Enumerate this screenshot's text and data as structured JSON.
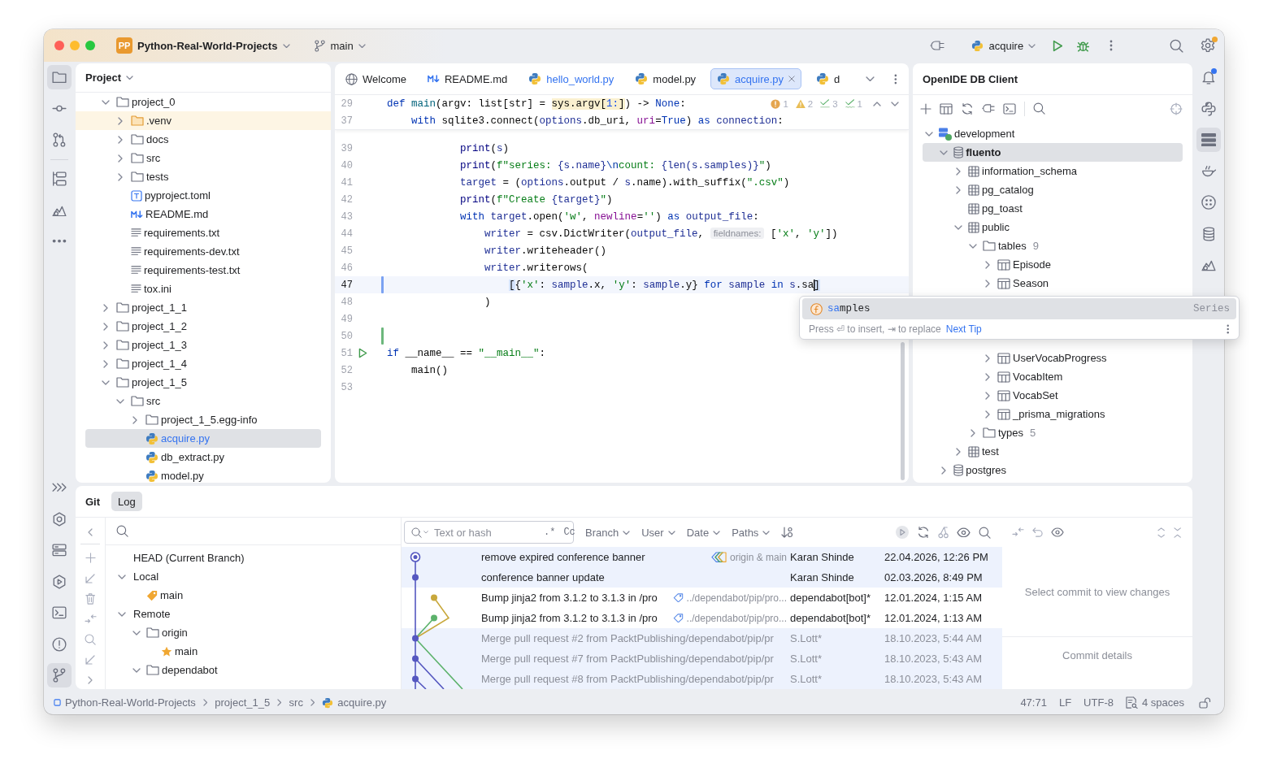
{
  "window": {
    "project_badge": "PP",
    "project_name": "Python-Real-World-Projects",
    "branch": "main",
    "run_config": "acquire",
    "settings_badge": true
  },
  "left_toolbar": {
    "top_groups": [
      [
        {
          "kind": "project",
          "selected": true
        },
        {
          "kind": "commit",
          "selected": false
        },
        {
          "kind": "pullrequests",
          "selected": false
        }
      ],
      [
        {
          "kind": "structure",
          "selected": false
        },
        {
          "kind": "packages",
          "selected": false
        },
        {
          "kind": "more",
          "selected": false
        }
      ]
    ],
    "bottom": [
      {
        "kind": "expand",
        "selected": false
      },
      {
        "kind": "pythonpackages",
        "selected": false
      },
      {
        "kind": "services",
        "selected": false
      },
      {
        "kind": "run",
        "selected": false
      },
      {
        "kind": "terminal",
        "selected": false
      },
      {
        "kind": "problems",
        "selected": false
      },
      {
        "kind": "git",
        "selected": true
      }
    ]
  },
  "right_toolbar": [
    {
      "kind": "notifications",
      "selected": false,
      "badge": true
    },
    {
      "kind": "console",
      "selected": false,
      "badge": false
    },
    {
      "kind": "dbclient",
      "selected": true,
      "badge": false
    },
    {
      "kind": "pot",
      "selected": false,
      "badge": false
    },
    {
      "kind": "dots",
      "selected": false,
      "badge": false
    },
    {
      "kind": "database",
      "selected": false,
      "badge": false
    },
    {
      "kind": "mountain",
      "selected": false,
      "badge": false
    }
  ],
  "project_panel": {
    "title": "Project",
    "tree": [
      {
        "label": "project_0",
        "kind": "folder",
        "expanded": true,
        "selected": false,
        "modified": false,
        "children": [
          {
            "label": ".venv",
            "kind": "venv",
            "expanded": false,
            "selected": false,
            "modified": false
          },
          {
            "label": "docs",
            "kind": "folder",
            "expanded": false,
            "selected": false,
            "modified": false
          },
          {
            "label": "src",
            "kind": "folder",
            "expanded": false,
            "selected": false,
            "modified": false
          },
          {
            "label": "tests",
            "kind": "folder",
            "expanded": false,
            "selected": false,
            "modified": false
          },
          {
            "label": "pyproject.toml",
            "kind": "toml",
            "selected": false,
            "modified": false
          },
          {
            "label": "README.md",
            "kind": "markdown",
            "selected": false,
            "modified": false
          },
          {
            "label": "requirements.txt",
            "kind": "text",
            "selected": false,
            "modified": false
          },
          {
            "label": "requirements-dev.txt",
            "kind": "text",
            "selected": false,
            "modified": false
          },
          {
            "label": "requirements-test.txt",
            "kind": "text",
            "selected": false,
            "modified": false
          },
          {
            "label": "tox.ini",
            "kind": "text",
            "selected": false,
            "modified": false
          }
        ]
      },
      {
        "label": "project_1_1",
        "kind": "folder",
        "expanded": false,
        "selected": false,
        "modified": false
      },
      {
        "label": "project_1_2",
        "kind": "folder",
        "expanded": false,
        "selected": false,
        "modified": false
      },
      {
        "label": "project_1_3",
        "kind": "folder",
        "expanded": false,
        "selected": false,
        "modified": false
      },
      {
        "label": "project_1_4",
        "kind": "folder",
        "expanded": false,
        "selected": false,
        "modified": false
      },
      {
        "label": "project_1_5",
        "kind": "folder",
        "expanded": true,
        "selected": false,
        "modified": false,
        "children": [
          {
            "label": "src",
            "kind": "folder",
            "expanded": true,
            "selected": false,
            "modified": false,
            "children": [
              {
                "label": "project_1_5.egg-info",
                "kind": "folder",
                "expanded": false,
                "selected": false,
                "modified": false
              },
              {
                "label": "acquire.py",
                "kind": "python",
                "selected": true,
                "modified": true
              },
              {
                "label": "db_extract.py",
                "kind": "python",
                "selected": false,
                "modified": false
              },
              {
                "label": "model.py",
                "kind": "python",
                "selected": false,
                "modified": false
              }
            ]
          }
        ]
      }
    ]
  },
  "editor": {
    "tabs": [
      {
        "label": "Welcome",
        "kind": "welcome",
        "selected": false,
        "modified": false
      },
      {
        "label": "README.md",
        "kind": "markdown",
        "selected": false,
        "modified": false
      },
      {
        "label": "hello_world.py",
        "kind": "python",
        "selected": false,
        "modified": true
      },
      {
        "label": "model.py",
        "kind": "python",
        "selected": false,
        "modified": false
      },
      {
        "label": "acquire.py",
        "kind": "python",
        "selected": true,
        "modified": true
      },
      {
        "label": "d",
        "kind": "python",
        "selected": false,
        "modified": false
      }
    ],
    "inspections": [
      {
        "kind": "error",
        "count": "1"
      },
      {
        "kind": "warning",
        "count": "2"
      },
      {
        "kind": "weak",
        "count": "3"
      },
      {
        "kind": "typo",
        "count": "1"
      }
    ],
    "sticky_lines": [
      {
        "number": "29",
        "tokens": [
          {
            "text": "def ",
            "kind": "keyword"
          },
          {
            "text": "main",
            "kind": "function"
          },
          {
            "text": "(argv: list[str] = ",
            "kind": "plain"
          },
          {
            "text": "sys.argv[",
            "kind": "warning"
          },
          {
            "text": "1:",
            "kind": "warning-number"
          },
          {
            "text": "]",
            "kind": "warning"
          },
          {
            "text": ") -> ",
            "kind": "plain"
          },
          {
            "text": "None",
            "kind": "keyword"
          },
          {
            "text": ":",
            "kind": "plain"
          }
        ]
      },
      {
        "number": "37",
        "tokens": [
          {
            "text": "    with",
            "kind": "keyword"
          },
          {
            "text": " sqlite3.connect(",
            "kind": "plain"
          },
          {
            "text": "options",
            "kind": "var"
          },
          {
            "text": ".db_uri, ",
            "kind": "plain"
          },
          {
            "text": "uri",
            "kind": "kwarg"
          },
          {
            "text": "=",
            "kind": "plain"
          },
          {
            "text": "True",
            "kind": "keyword"
          },
          {
            "text": ") ",
            "kind": "plain"
          },
          {
            "text": "as",
            "kind": "keyword"
          },
          {
            "text": " connection",
            "kind": "var"
          },
          {
            "text": ":",
            "kind": "plain"
          }
        ]
      }
    ],
    "lines": [
      {
        "number": "39",
        "current": false,
        "runnable": false,
        "tokens": [
          {
            "text": "            print",
            "kind": "builtin"
          },
          {
            "text": "(",
            "kind": "plain"
          },
          {
            "text": "s",
            "kind": "var"
          },
          {
            "text": ")",
            "kind": "plain"
          }
        ]
      },
      {
        "number": "40",
        "current": false,
        "runnable": false,
        "tokens": [
          {
            "text": "            print",
            "kind": "builtin"
          },
          {
            "text": "(",
            "kind": "plain"
          },
          {
            "text": "f\"series: ",
            "kind": "string"
          },
          {
            "text": "{s.name}",
            "kind": "var"
          },
          {
            "text": "\\n",
            "kind": "escape"
          },
          {
            "text": "count: ",
            "kind": "string"
          },
          {
            "text": "{len(s.samples)}",
            "kind": "var"
          },
          {
            "text": "\"",
            "kind": "string"
          },
          {
            "text": ")",
            "kind": "plain"
          }
        ]
      },
      {
        "number": "41",
        "current": false,
        "runnable": false,
        "tokens": [
          {
            "text": "            target",
            "kind": "var"
          },
          {
            "text": " = (",
            "kind": "plain"
          },
          {
            "text": "options",
            "kind": "var"
          },
          {
            "text": ".output / ",
            "kind": "plain"
          },
          {
            "text": "s",
            "kind": "var"
          },
          {
            "text": ".name).with_suffix(",
            "kind": "plain"
          },
          {
            "text": "\".csv\"",
            "kind": "string"
          },
          {
            "text": ")",
            "kind": "plain"
          }
        ]
      },
      {
        "number": "42",
        "current": false,
        "runnable": false,
        "tokens": [
          {
            "text": "            print",
            "kind": "builtin"
          },
          {
            "text": "(",
            "kind": "plain"
          },
          {
            "text": "f\"Create ",
            "kind": "string"
          },
          {
            "text": "{target}",
            "kind": "var"
          },
          {
            "text": "\"",
            "kind": "string"
          },
          {
            "text": ")",
            "kind": "plain"
          }
        ]
      },
      {
        "number": "43",
        "current": false,
        "runnable": false,
        "tokens": [
          {
            "text": "            with",
            "kind": "keyword"
          },
          {
            "text": " target",
            "kind": "var"
          },
          {
            "text": ".open(",
            "kind": "plain"
          },
          {
            "text": "'w'",
            "kind": "string"
          },
          {
            "text": ", ",
            "kind": "plain"
          },
          {
            "text": "newline",
            "kind": "kwarg"
          },
          {
            "text": "=",
            "kind": "plain"
          },
          {
            "text": "''",
            "kind": "string"
          },
          {
            "text": ") ",
            "kind": "plain"
          },
          {
            "text": "as",
            "kind": "keyword"
          },
          {
            "text": " output_file",
            "kind": "var"
          },
          {
            "text": ":",
            "kind": "plain"
          }
        ]
      },
      {
        "number": "44",
        "current": false,
        "runnable": false,
        "tokens": [
          {
            "text": "                writer",
            "kind": "var"
          },
          {
            "text": " = csv.DictWriter(",
            "kind": "plain"
          },
          {
            "text": "output_file",
            "kind": "var"
          },
          {
            "text": ", ",
            "kind": "plain"
          },
          {
            "text": "fieldnames:",
            "kind": "hint"
          },
          {
            "text": " [",
            "kind": "plain"
          },
          {
            "text": "'x'",
            "kind": "string"
          },
          {
            "text": ", ",
            "kind": "plain"
          },
          {
            "text": "'y'",
            "kind": "string"
          },
          {
            "text": "])",
            "kind": "plain"
          }
        ]
      },
      {
        "number": "45",
        "current": false,
        "runnable": false,
        "tokens": [
          {
            "text": "                writer",
            "kind": "var"
          },
          {
            "text": ".writeheader()",
            "kind": "plain"
          }
        ]
      },
      {
        "number": "46",
        "current": false,
        "runnable": false,
        "tokens": [
          {
            "text": "                writer",
            "kind": "var"
          },
          {
            "text": ".writerows(",
            "kind": "plain"
          }
        ]
      },
      {
        "number": "47",
        "current": true,
        "runnable": false,
        "change": {
          "kind": "modified"
        },
        "tokens": [
          {
            "text": "                    [",
            "kind": "bracket"
          },
          {
            "text": "{",
            "kind": "plain"
          },
          {
            "text": "'x'",
            "kind": "string"
          },
          {
            "text": ": ",
            "kind": "plain"
          },
          {
            "text": "sample",
            "kind": "var"
          },
          {
            "text": ".x, ",
            "kind": "plain"
          },
          {
            "text": "'y'",
            "kind": "string"
          },
          {
            "text": ": ",
            "kind": "plain"
          },
          {
            "text": "sample",
            "kind": "var"
          },
          {
            "text": ".y} ",
            "kind": "plain"
          },
          {
            "text": "for",
            "kind": "keyword"
          },
          {
            "text": " sample",
            "kind": "var"
          },
          {
            "text": " in",
            "kind": "keyword"
          },
          {
            "text": " s",
            "kind": "var"
          },
          {
            "text": ".sa",
            "kind": "plain"
          },
          {
            "text": "]",
            "kind": "caret-bracket"
          }
        ]
      },
      {
        "number": "48",
        "current": false,
        "runnable": false,
        "tokens": [
          {
            "text": "                )",
            "kind": "plain"
          }
        ]
      },
      {
        "number": "49",
        "current": false,
        "runnable": false
      },
      {
        "number": "50",
        "current": false,
        "runnable": false,
        "change": {
          "kind": "added"
        }
      },
      {
        "number": "51",
        "current": false,
        "runnable": true,
        "tokens": [
          {
            "text": "if",
            "kind": "keyword"
          },
          {
            "text": " __name__ == ",
            "kind": "plain"
          },
          {
            "text": "\"__main__\"",
            "kind": "string"
          },
          {
            "text": ":",
            "kind": "plain"
          }
        ]
      },
      {
        "number": "52",
        "current": false,
        "runnable": false,
        "tokens": [
          {
            "text": "    main()",
            "kind": "plain"
          }
        ]
      },
      {
        "number": "53",
        "current": false,
        "runnable": false
      }
    ]
  },
  "completion": {
    "items": [
      {
        "match": "sa",
        "rest": "mples",
        "type": "Series",
        "selected": true
      }
    ],
    "hint": "Press ⏎ to insert, ⇥ to replace",
    "link": "Next Tip"
  },
  "db_panel": {
    "title": "OpenIDE DB Client",
    "tree": [
      {
        "label": "development",
        "kind": "connection",
        "expanded": true,
        "selected": false,
        "children": [
          {
            "label": "fluento",
            "kind": "database",
            "expanded": true,
            "selected": true,
            "active": true,
            "children": [
              {
                "label": "information_schema",
                "kind": "schema",
                "expanded": false,
                "selected": false
              },
              {
                "label": "pg_catalog",
                "kind": "schema",
                "expanded": false,
                "selected": false
              },
              {
                "label": "pg_toast",
                "kind": "schema",
                "selected": false
              },
              {
                "label": "public",
                "kind": "schema",
                "expanded": true,
                "selected": false,
                "children": [
                  {
                    "label": "tables",
                    "kind": "folder",
                    "count": "9",
                    "expanded": true,
                    "selected": false,
                    "children": [
                      {
                        "label": "Episode",
                        "kind": "table",
                        "expanded": false,
                        "selected": false
                      },
                      {
                        "label": "Season",
                        "kind": "table",
                        "expanded": false,
                        "selected": false
                      },
                      {
                        "label": "UserVocabProgress",
                        "kind": "table",
                        "expanded": false,
                        "selected": false
                      },
                      {
                        "label": "VocabItem",
                        "kind": "table",
                        "expanded": false,
                        "selected": false
                      },
                      {
                        "label": "VocabSet",
                        "kind": "table",
                        "expanded": false,
                        "selected": false
                      },
                      {
                        "label": "_prisma_migrations",
                        "kind": "table",
                        "expanded": false,
                        "selected": false
                      }
                    ]
                  },
                  {
                    "label": "types",
                    "kind": "folder",
                    "count": "5",
                    "expanded": false,
                    "selected": false
                  }
                ]
              },
              {
                "label": "test",
                "kind": "schema",
                "expanded": false,
                "selected": false
              }
            ]
          },
          {
            "label": "postgres",
            "kind": "database",
            "expanded": false,
            "selected": false,
            "active": false
          }
        ]
      }
    ]
  },
  "git_panel": {
    "title": "Git",
    "tabs": [
      {
        "label": "Log",
        "selected": true
      }
    ],
    "branches": [
      {
        "label": "HEAD (Current Branch)"
      },
      {
        "label": "Local",
        "expanded": true,
        "children": [
          {
            "label": "main",
            "kind": "current"
          }
        ]
      },
      {
        "label": "Remote",
        "expanded": true,
        "children": [
          {
            "label": "origin",
            "kind": "folder",
            "expanded": true,
            "children": [
              {
                "label": "main",
                "kind": "favorite"
              }
            ]
          },
          {
            "label": "dependabot",
            "kind": "folder",
            "expanded": true
          }
        ]
      }
    ],
    "log": {
      "search_placeholder": "Text or hash",
      "regex_toggle": ".*",
      "case_toggle": "Cc",
      "filters": [
        "Branch",
        "User",
        "Date",
        "Paths"
      ],
      "commits": [
        {
          "subject": "remove expired conference banner",
          "refs": {
            "label": "origin & main",
            "kind": "multiple"
          },
          "author": "Karan Shinde",
          "date": "22.04.2026, 12:26 PM",
          "highlighted": true,
          "dimmed": false,
          "head": true,
          "color": "#5457c0"
        },
        {
          "subject": "conference banner update",
          "author": "Karan Shinde",
          "date": "02.03.2026, 8:49 PM",
          "highlighted": true,
          "dimmed": false,
          "head": false,
          "color": "#5457c0"
        },
        {
          "subject": "Bump jinja2 from 3.1.2 to 3.1.3 in /pro",
          "refs": {
            "label": "../dependabot/pip/pro...",
            "kind": "single"
          },
          "author": "dependabot[bot]*",
          "date": "12.01.2024, 1:15 AM",
          "highlighted": false,
          "dimmed": false,
          "head": false,
          "color": "#c8a83c"
        },
        {
          "subject": "Bump jinja2 from 3.1.2 to 3.1.3 in /pro",
          "refs": {
            "label": "../dependabot/pip/pro...",
            "kind": "single"
          },
          "author": "dependabot[bot]*",
          "date": "12.01.2024, 1:13 AM",
          "highlighted": false,
          "dimmed": false,
          "head": false,
          "color": "#5cb26b"
        },
        {
          "subject": "Merge pull request #2 from PacktPublishing/dependabot/pip/pr",
          "author": "S.Lott*",
          "date": "18.10.2023, 5:44 AM",
          "highlighted": true,
          "dimmed": true,
          "head": false,
          "color": "#5457c0"
        },
        {
          "subject": "Merge pull request #7 from PacktPublishing/dependabot/pip/pr",
          "author": "S.Lott*",
          "date": "18.10.2023, 5:43 AM",
          "highlighted": true,
          "dimmed": true,
          "head": false,
          "color": "#5457c0"
        },
        {
          "subject": "Merge pull request #8 from PacktPublishing/dependabot/pip/pr",
          "author": "S.Lott*",
          "date": "18.10.2023, 5:43 AM",
          "highlighted": true,
          "dimmed": true,
          "head": false,
          "color": "#5457c0"
        }
      ]
    },
    "details": {
      "changes_hint": "Select commit to view changes",
      "details_hint": "Commit details"
    }
  },
  "status_bar": {
    "breadcrumbs": [
      {
        "label": "Python-Real-World-Projects",
        "kind": "project"
      },
      {
        "label": "project_1_5",
        "kind": "folder"
      },
      {
        "label": "src",
        "kind": "folder"
      },
      {
        "label": "acquire.py",
        "kind": "python"
      }
    ],
    "position": "47:71",
    "line_ending": "LF",
    "encoding": "UTF-8",
    "indent": "4 spaces"
  }
}
